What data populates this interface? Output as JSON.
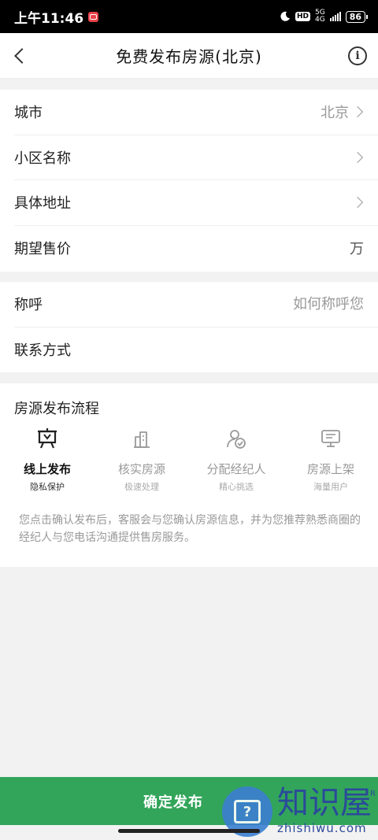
{
  "status_bar": {
    "time": "上午11:46",
    "network_top": "5G",
    "network_bottom": "4G",
    "hd": "HD",
    "battery": "86"
  },
  "header": {
    "title": "免费发布房源(北京)",
    "info_icon": "i"
  },
  "form": {
    "city": {
      "label": "城市",
      "value": "北京"
    },
    "community": {
      "label": "小区名称",
      "value": ""
    },
    "address": {
      "label": "具体地址",
      "value": ""
    },
    "price": {
      "label": "期望售价",
      "unit": "万",
      "value": ""
    },
    "name": {
      "label": "称呼",
      "placeholder": "如何称呼您",
      "value": ""
    },
    "contact": {
      "label": "联系方式",
      "value": ""
    }
  },
  "flow": {
    "title": "房源发布流程",
    "steps": [
      {
        "name": "线上发布",
        "sub": "隐私保护",
        "icon": "podium-icon",
        "active": true
      },
      {
        "name": "核实房源",
        "sub": "极速处理",
        "icon": "buildings-icon",
        "active": false
      },
      {
        "name": "分配经纪人",
        "sub": "精心挑选",
        "icon": "agent-check-icon",
        "active": false
      },
      {
        "name": "房源上架",
        "sub": "海量用户",
        "icon": "monitor-icon",
        "active": false
      }
    ],
    "description": "您点击确认发布后，客服会与您确认房源信息，并为您推荐熟悉商圈的经纪人与您电话沟通提供售房服务。"
  },
  "confirm_button": "确定发布",
  "watermark": {
    "brand": "知识屋",
    "domain": "zhishiwu.com",
    "reg": "R"
  },
  "colors": {
    "accent_green": "#32a55a",
    "muted_text": "#999999"
  }
}
